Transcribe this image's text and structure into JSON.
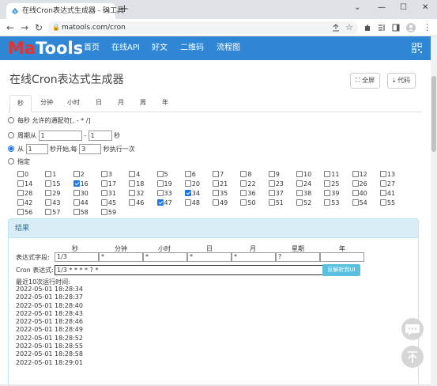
{
  "browser": {
    "tab_title": "在线Cron表达式生成器 - 码工具",
    "tab_close": "×",
    "new_tab": "+",
    "url": "matools.com/cron",
    "window_controls": [
      "⌄",
      "—",
      "☐",
      "✕"
    ]
  },
  "site": {
    "logo_ma": "Ma",
    "logo_tools": "Tools",
    "nav": [
      "首页",
      "在线API",
      "好文",
      "二维码",
      "流程图"
    ]
  },
  "page": {
    "title": "在线Cron表达式生成器",
    "fullscreen_label": "全屏",
    "code_label": "代码",
    "tabs": [
      "秒",
      "分钟",
      "小时",
      "日",
      "月",
      "周",
      "年"
    ],
    "active_tab": "秒"
  },
  "options": {
    "every": "每秒 允许的通配符[, - * /]",
    "cycle_prefix": "周期从",
    "cycle_from": "1",
    "cycle_dash": "-",
    "cycle_to": "1",
    "cycle_unit": "秒",
    "from_prefix": "从",
    "from_start": "1",
    "from_mid": "秒开始,每",
    "from_every": "3",
    "from_suffix": "秒执行一次",
    "specify": "指定",
    "selected": "from"
  },
  "checkboxes": {
    "labels": [
      "0",
      "1",
      "2",
      "3",
      "4",
      "5",
      "6",
      "7",
      "8",
      "9",
      "10",
      "11",
      "12",
      "13",
      "14",
      "15",
      "16",
      "17",
      "18",
      "19",
      "20",
      "21",
      "22",
      "23",
      "24",
      "25",
      "26",
      "27",
      "28",
      "29",
      "30",
      "31",
      "32",
      "33",
      "34",
      "35",
      "36",
      "37",
      "38",
      "39",
      "40",
      "41",
      "42",
      "43",
      "44",
      "45",
      "46",
      "47",
      "48",
      "49",
      "50",
      "51",
      "52",
      "53",
      "54",
      "55",
      "56",
      "57",
      "58",
      "59"
    ],
    "checked": [
      "16",
      "34",
      "47"
    ]
  },
  "result": {
    "title": "结果",
    "columns": [
      "秒",
      "分钟",
      "小时",
      "日",
      "月",
      "星期",
      "年"
    ],
    "field_label": "表达式字段:",
    "fields": [
      "1/3",
      "*",
      "*",
      "*",
      "*",
      "?",
      ""
    ],
    "cron_label": "Cron 表达式:",
    "cron_value": "1/3 * * * * ? *",
    "parse_button": "反解析到UI",
    "runs_title": "最近10次运行时间:",
    "runs": [
      "2022-05-01 18:28:34",
      "2022-05-01 18:28:37",
      "2022-05-01 18:28:40",
      "2022-05-01 18:28:43",
      "2022-05-01 18:28:46",
      "2022-05-01 18:28:49",
      "2022-05-01 18:28:52",
      "2022-05-01 18:28:55",
      "2022-05-01 18:28:58",
      "2022-05-01 18:29:01"
    ]
  },
  "colors": {
    "header": "#2e86d4",
    "logo_red": "#e8322c",
    "checkbox_on": "#1a73e8",
    "panel_head": "#d9edf7",
    "parse_button": "#5bc0de"
  }
}
